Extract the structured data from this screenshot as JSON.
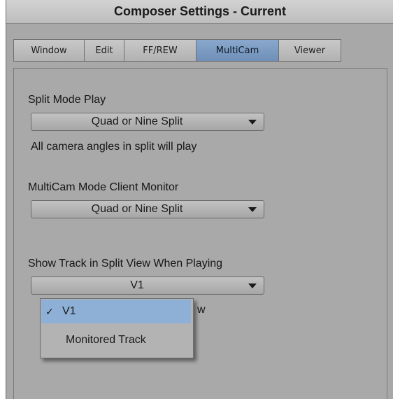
{
  "window": {
    "title": "Composer Settings - Current"
  },
  "tabs": [
    {
      "label": "Window"
    },
    {
      "label": "Edit"
    },
    {
      "label": "FF/REW"
    },
    {
      "label": "MultiCam",
      "active": true
    },
    {
      "label": "Viewer"
    }
  ],
  "settings": {
    "split_mode": {
      "label": "Split Mode Play",
      "value": "Quad or Nine Split",
      "note": "All camera angles in split will play"
    },
    "client_monitor": {
      "label": "MultiCam Mode Client Monitor",
      "value": "Quad or Nine Split"
    },
    "show_track": {
      "label": "Show Track in Split View When Playing",
      "value": "V1",
      "obscured_note_tail": "w"
    }
  },
  "menu": {
    "items": [
      {
        "label": "V1",
        "checked": true,
        "check_glyph": "✓"
      },
      {
        "label": "Monitored Track",
        "checked": false
      }
    ]
  },
  "colors": {
    "accent": "#7a98c0",
    "panel": "#a9a9a9",
    "menu_highlight": "#8fb0d6"
  }
}
